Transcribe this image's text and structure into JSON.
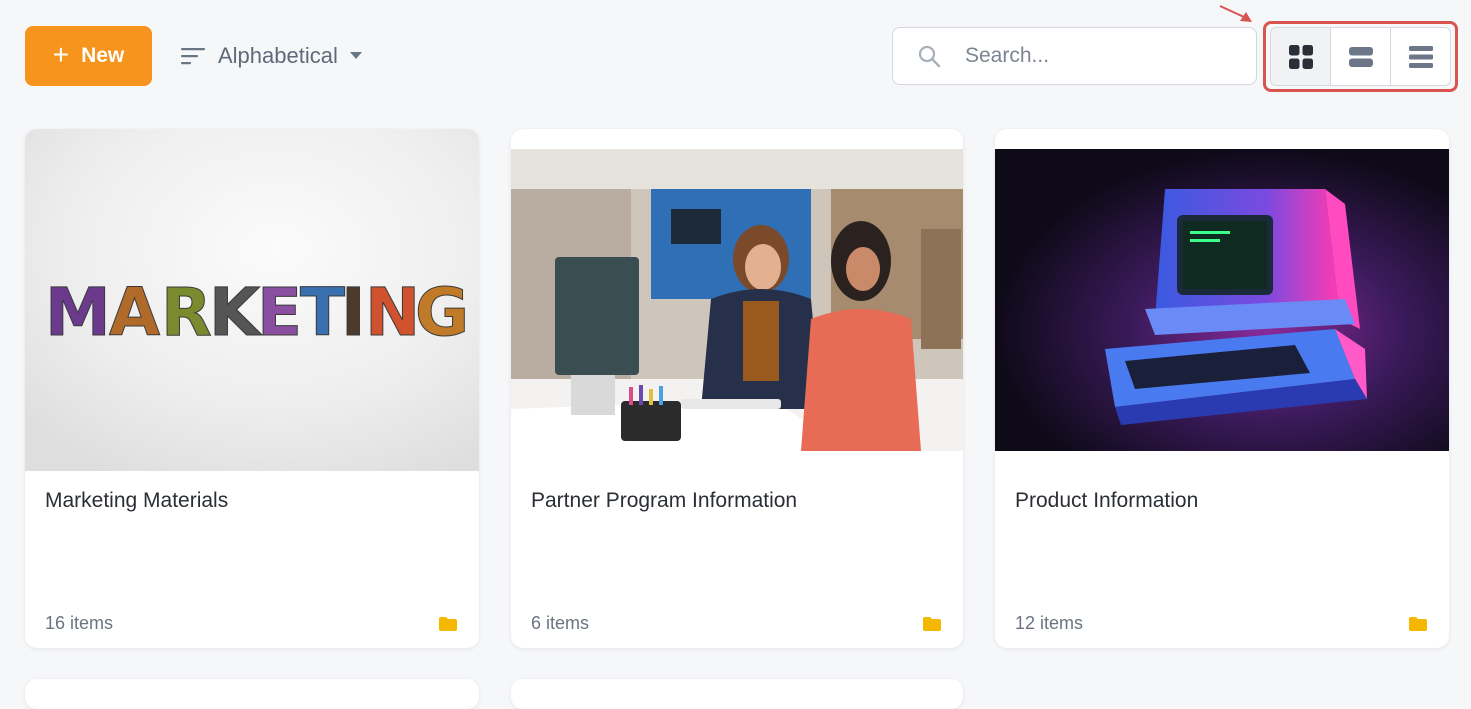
{
  "toolbar": {
    "new_label": "New",
    "new_icon": "+",
    "sort_label": "Alphabetical",
    "search_placeholder": "Search...",
    "accent_color": "#f7941d",
    "highlight_color": "#d9534f"
  },
  "view_modes": [
    {
      "name": "grid",
      "icon": "grid-icon",
      "active": true
    },
    {
      "name": "cards-list",
      "icon": "rows-icon",
      "active": false
    },
    {
      "name": "list",
      "icon": "list-icon",
      "active": false
    }
  ],
  "folders": [
    {
      "title": "Marketing Materials",
      "count": "16 items",
      "image": "marketing-letters"
    },
    {
      "title": "Partner Program Information",
      "count": "6 items",
      "image": "office-meeting"
    },
    {
      "title": "Product Information",
      "count": "12 items",
      "image": "retro-computer"
    }
  ],
  "folder_icon_color": "#f5b800"
}
